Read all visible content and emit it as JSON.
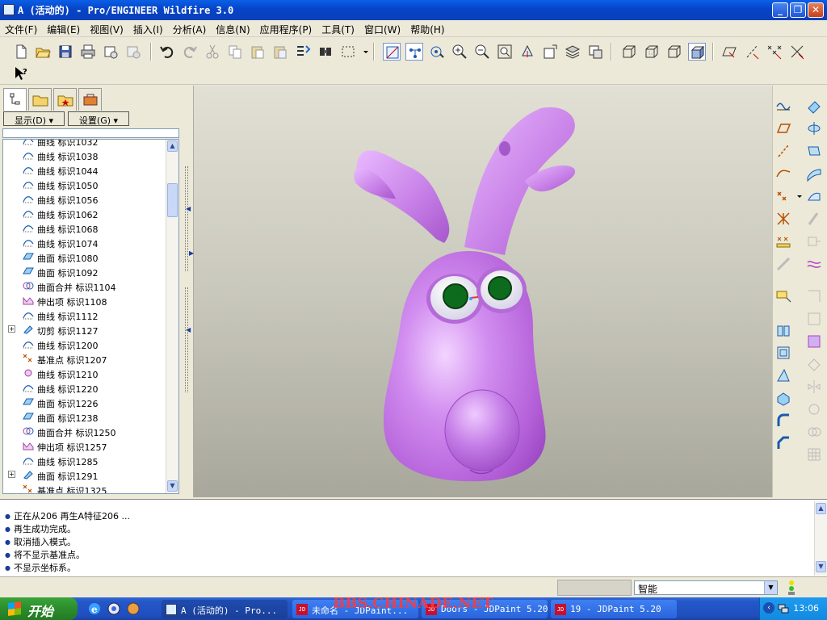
{
  "window": {
    "title": "A (活动的) - Pro/ENGINEER Wildfire 3.0",
    "controls": [
      "minimize",
      "maximize",
      "close"
    ]
  },
  "menu": [
    "文件(F)",
    "编辑(E)",
    "视图(V)",
    "插入(I)",
    "分析(A)",
    "信息(N)",
    "应用程序(P)",
    "工具(T)",
    "窗口(W)",
    "帮助(H)"
  ],
  "model_tree": {
    "display_label": "显示(D)",
    "settings_label": "设置(G)",
    "items": [
      {
        "label": "曲线 标识1032",
        "icon": "curve-icon",
        "expand": false
      },
      {
        "label": "曲线 标识1038",
        "icon": "curve-icon",
        "expand": false
      },
      {
        "label": "曲线 标识1044",
        "icon": "curve-icon",
        "expand": false
      },
      {
        "label": "曲线 标识1050",
        "icon": "curve-icon",
        "expand": false
      },
      {
        "label": "曲线 标识1056",
        "icon": "curve-icon",
        "expand": false
      },
      {
        "label": "曲线 标识1062",
        "icon": "curve-icon",
        "expand": false
      },
      {
        "label": "曲线 标识1068",
        "icon": "curve-icon",
        "expand": false
      },
      {
        "label": "曲线 标识1074",
        "icon": "curve-icon",
        "expand": false
      },
      {
        "label": "曲面 标识1080",
        "icon": "surface-icon",
        "expand": false
      },
      {
        "label": "曲面 标识1092",
        "icon": "surface-icon",
        "expand": false
      },
      {
        "label": "曲面合并 标识1104",
        "icon": "merge-icon",
        "expand": false
      },
      {
        "label": "伸出项 标识1108",
        "icon": "protrusion-icon",
        "expand": false
      },
      {
        "label": "曲线 标识1112",
        "icon": "curve-icon",
        "expand": false
      },
      {
        "label": "切剪 标识1127",
        "icon": "cut-icon",
        "expand": true
      },
      {
        "label": "曲线 标识1200",
        "icon": "curve-icon",
        "expand": false
      },
      {
        "label": "基准点 标识1207",
        "icon": "datum-point-icon",
        "expand": false
      },
      {
        "label": "曲线 标识1210",
        "icon": "sketch-curve-icon",
        "expand": false
      },
      {
        "label": "曲线 标识1220",
        "icon": "curve-icon",
        "expand": false
      },
      {
        "label": "曲面 标识1226",
        "icon": "surface-icon",
        "expand": false
      },
      {
        "label": "曲面 标识1238",
        "icon": "surface-icon",
        "expand": false
      },
      {
        "label": "曲面合并 标识1250",
        "icon": "merge-icon",
        "expand": false
      },
      {
        "label": "伸出项 标识1257",
        "icon": "protrusion-icon",
        "expand": false
      },
      {
        "label": "曲线 标识1285",
        "icon": "curve-icon",
        "expand": false
      },
      {
        "label": "曲面 标识1291",
        "icon": "cut-icon",
        "expand": true
      },
      {
        "label": "基准点 标识1325",
        "icon": "datum-point-icon",
        "expand": false
      }
    ]
  },
  "messages": [
    "正在从206 再生A特征206 ...",
    "再生成功完成。",
    "取消插入模式。",
    "将不显示基准点。",
    "不显示坐标系。"
  ],
  "status": {
    "filter_value": "智能"
  },
  "taskbar": {
    "start_label": "开始",
    "tasks": [
      {
        "label": "A (活动的) - Pro...",
        "active": true
      },
      {
        "label": "未命名 - JDPaint...",
        "active": false
      },
      {
        "label": "Doors - JDPaint 5.20",
        "active": false
      },
      {
        "label": "19 - JDPaint 5.20",
        "active": false
      }
    ],
    "clock": "13:06",
    "watermark": "BBS.CHINADE.NET"
  },
  "colors": {
    "model_purple": "#c77ee8",
    "eye_green": "#0d6b1e",
    "titlebar_blue": "#0a4fd8",
    "taskbar_blue": "#2457c8"
  }
}
